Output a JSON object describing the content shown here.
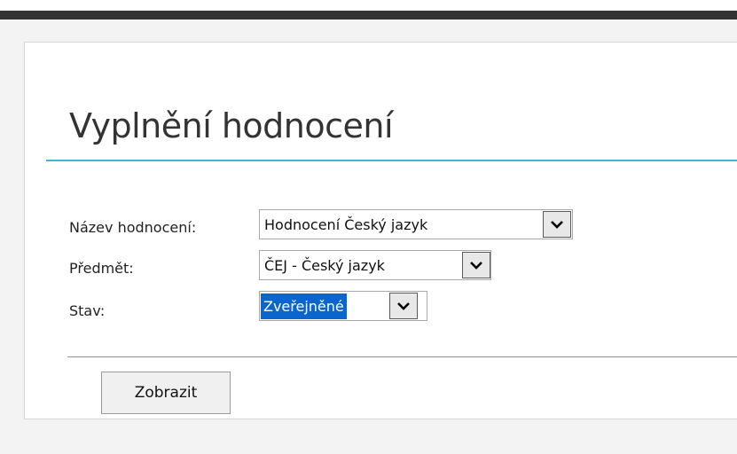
{
  "header": {
    "title": "Vyplnění hodnocení"
  },
  "form": {
    "fields": [
      {
        "label": "Název hodnocení:",
        "value": "Hodnocení Český jazyk",
        "icon": "chevron-down-icon"
      },
      {
        "label": "Předmět:",
        "value": "ČEJ - Český jazyk",
        "icon": "chevron-down-icon"
      },
      {
        "label": "Stav:",
        "value": "Zveřejněné",
        "icon": "chevron-down-icon"
      }
    ],
    "submit_label": "Zobrazit"
  },
  "colors": {
    "accent_rule": "#3bb8d4",
    "selection": "#0a66cc",
    "top_bar": "#333333"
  }
}
